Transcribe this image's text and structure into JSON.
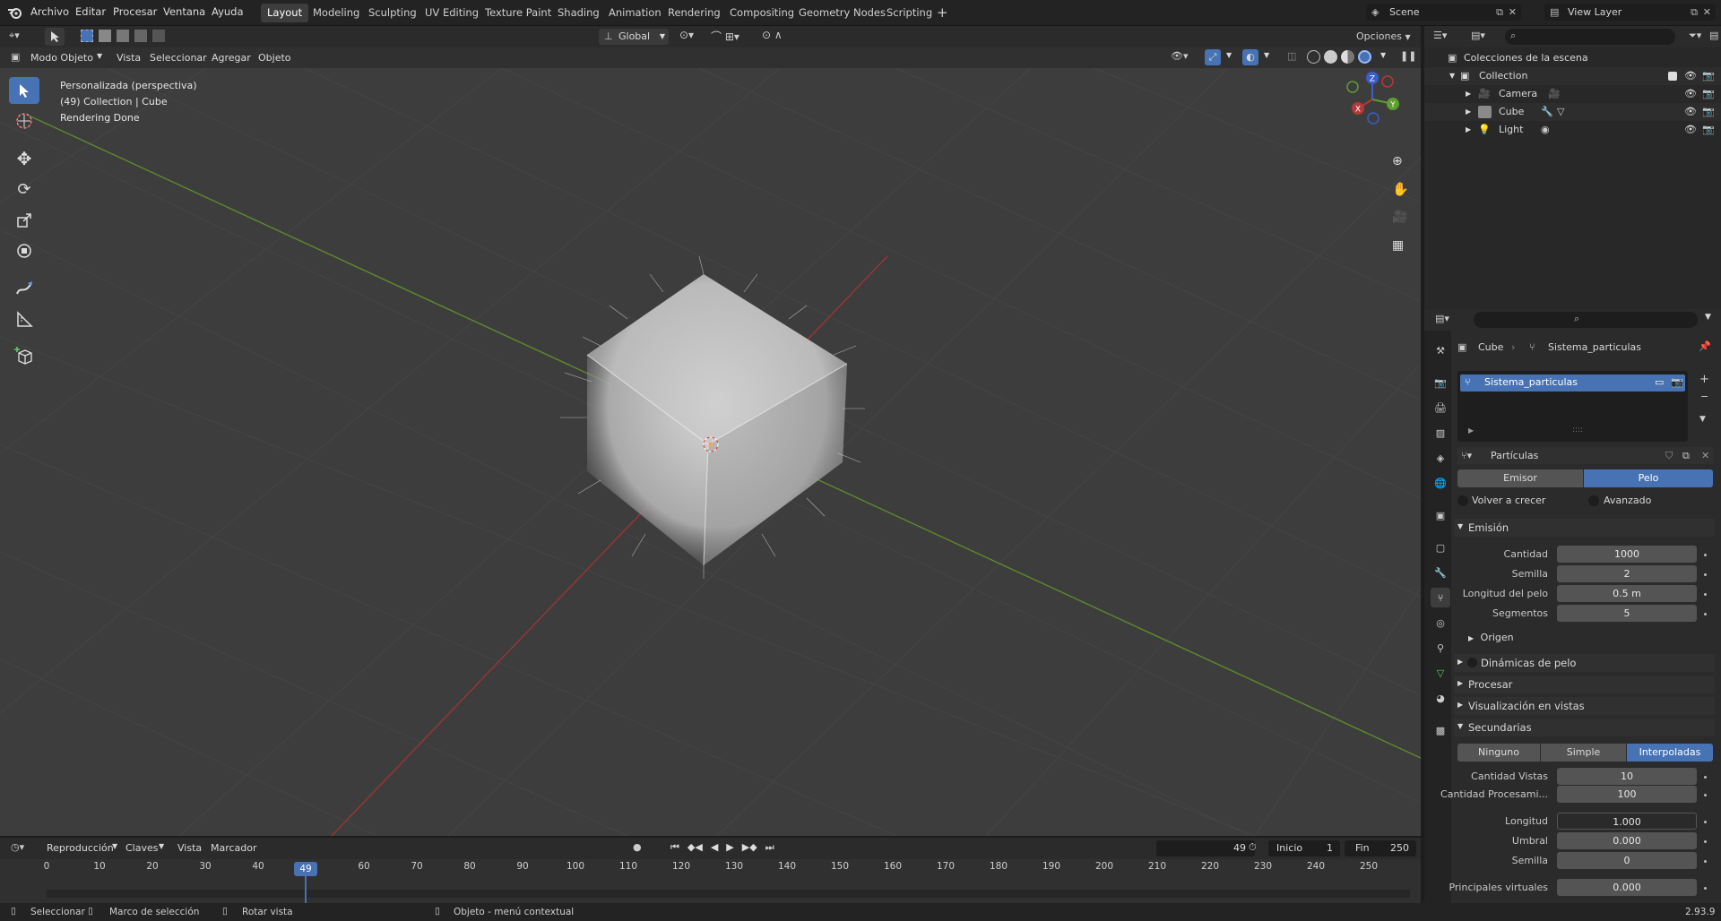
{
  "app": {
    "version": "2.93.9"
  },
  "menu": [
    "Archivo",
    "Editar",
    "Procesar",
    "Ventana",
    "Ayuda"
  ],
  "workspaces": [
    "Layout",
    "Modeling",
    "Sculpting",
    "UV Editing",
    "Texture Paint",
    "Shading",
    "Animation",
    "Rendering",
    "Compositing",
    "Geometry Nodes",
    "Scripting"
  ],
  "scene": {
    "scene_name": "Scene",
    "view_layer": "View Layer"
  },
  "header": {
    "transform_orientation": "Global",
    "options_label": "Opciones",
    "mode": "Modo Objeto",
    "view_menu": "Vista",
    "select_menu": "Seleccionar",
    "add_menu": "Agregar",
    "object_menu": "Objeto"
  },
  "viewport": {
    "view_name": "Personalizada (perspectiva)",
    "collection_info": "(49) Collection | Cube",
    "render_status": "Rendering Done",
    "gizmo": {
      "x": "X",
      "y": "Y",
      "z": "Z"
    }
  },
  "outliner": {
    "title": "Colecciones de la escena",
    "collection": "Collection",
    "items": [
      "Camera",
      "Cube",
      "Light"
    ]
  },
  "properties": {
    "breadcrumb_object": "Cube",
    "breadcrumb_system": "Sistema_particulas",
    "system_name": "Sistema_particulas",
    "settings_name": "Partículas",
    "type_options": [
      "Emisor",
      "Pelo"
    ],
    "type_selected": "Pelo",
    "regrow_label": "Volver a crecer",
    "advanced_label": "Avanzado",
    "emission": {
      "title": "Emisión",
      "amount_label": "Cantidad",
      "amount": "1000",
      "seed_label": "Semilla",
      "seed": "2",
      "hair_length_label": "Longitud del pelo",
      "hair_length": "0.5 m",
      "segments_label": "Segmentos",
      "segments": "5",
      "origin_label": "Origen"
    },
    "sections": [
      "Dinámicas de pelo",
      "Procesar",
      "Visualización en vistas"
    ],
    "children": {
      "title": "Secundarias",
      "modes": [
        "Ninguno",
        "Simple",
        "Interpoladas"
      ],
      "mode_selected": "Interpoladas",
      "display_amount_label": "Cantidad  Vistas",
      "display_amount": "10",
      "render_amount_label": "Cantidad  Procesami...",
      "render_amount": "100",
      "length_label": "Longitud",
      "length": "1.000",
      "threshold_label": "Umbral",
      "threshold": "0.000",
      "seed_label": "Semilla",
      "seed": "0",
      "virtual_parents_label": "Principales virtuales",
      "virtual_parents": "0.000"
    }
  },
  "timeline": {
    "menus": [
      "Reproducción",
      "Claves",
      "Vista",
      "Marcador"
    ],
    "current_frame": "49",
    "start_label": "Inicio",
    "start": "1",
    "end_label": "Fin",
    "end": "250",
    "ruler": [
      "0",
      "10",
      "20",
      "30",
      "40",
      "49",
      "60",
      "70",
      "80",
      "90",
      "100",
      "110",
      "120",
      "130",
      "140",
      "150",
      "160",
      "170",
      "180",
      "190",
      "200",
      "210",
      "220",
      "230",
      "240",
      "250"
    ]
  },
  "status": {
    "select": "Seleccionar",
    "box_select": "Marco de selección",
    "rotate": "Rotar vista",
    "context_menu": "Objeto - menú contextual"
  },
  "colors": {
    "accent": "#4772b3",
    "x_axis": "#b33a3a",
    "y_axis": "#5d9e2e",
    "z_axis": "#3b5ec9"
  }
}
